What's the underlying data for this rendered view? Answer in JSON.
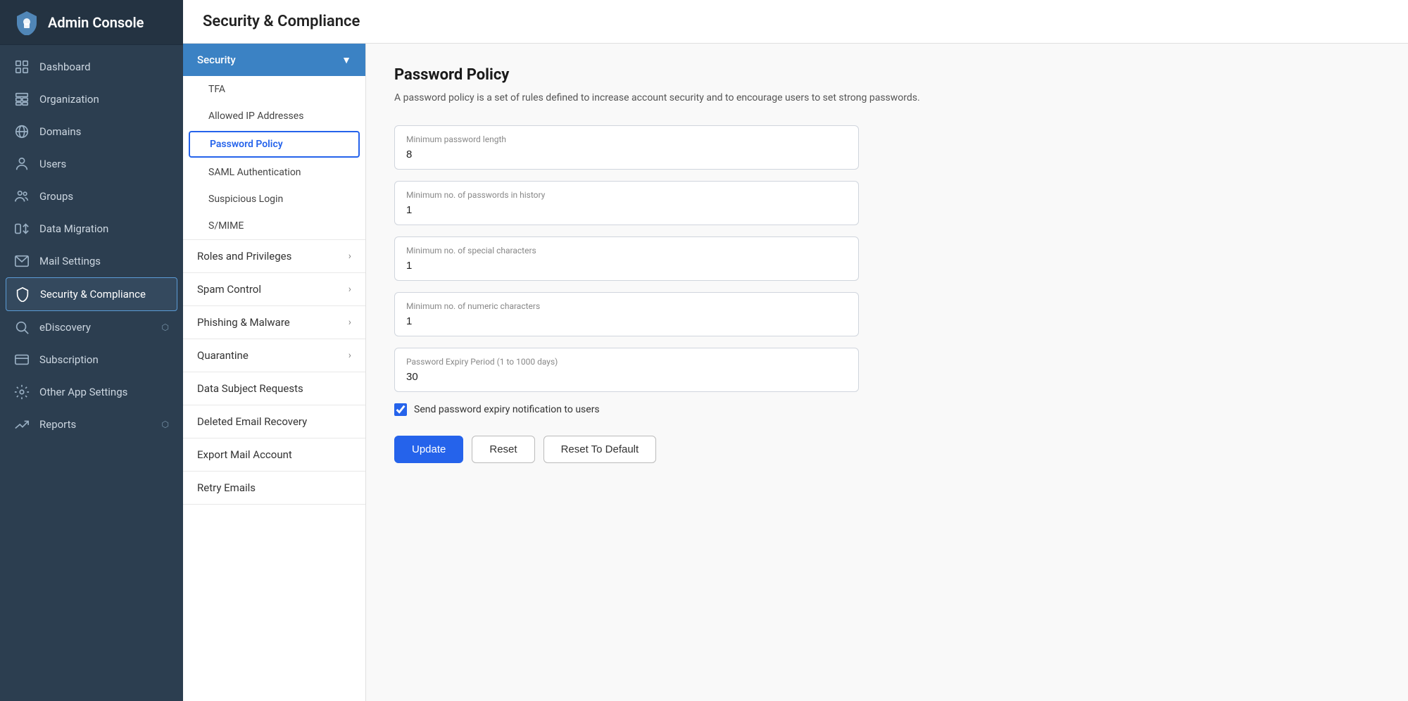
{
  "app": {
    "title": "Admin Console"
  },
  "sidebar": {
    "items": [
      {
        "id": "dashboard",
        "label": "Dashboard",
        "icon": "dashboard"
      },
      {
        "id": "organization",
        "label": "Organization",
        "icon": "organization"
      },
      {
        "id": "domains",
        "label": "Domains",
        "icon": "domains"
      },
      {
        "id": "users",
        "label": "Users",
        "icon": "users"
      },
      {
        "id": "groups",
        "label": "Groups",
        "icon": "groups"
      },
      {
        "id": "data-migration",
        "label": "Data Migration",
        "icon": "data-migration"
      },
      {
        "id": "mail-settings",
        "label": "Mail Settings",
        "icon": "mail-settings"
      },
      {
        "id": "security-compliance",
        "label": "Security & Compliance",
        "icon": "security",
        "active": true
      },
      {
        "id": "ediscovery",
        "label": "eDiscovery",
        "icon": "ediscovery",
        "ext": true
      },
      {
        "id": "subscription",
        "label": "Subscription",
        "icon": "subscription"
      },
      {
        "id": "other-app-settings",
        "label": "Other App Settings",
        "icon": "other-app"
      },
      {
        "id": "reports",
        "label": "Reports",
        "icon": "reports",
        "ext": true
      }
    ]
  },
  "page": {
    "title": "Security & Compliance"
  },
  "sub_sidebar": {
    "security_section": {
      "label": "Security",
      "items": [
        {
          "id": "tfa",
          "label": "TFA",
          "active": false
        },
        {
          "id": "allowed-ip",
          "label": "Allowed IP Addresses",
          "active": false
        },
        {
          "id": "password-policy",
          "label": "Password Policy",
          "active": true
        },
        {
          "id": "saml",
          "label": "SAML Authentication",
          "active": false
        },
        {
          "id": "suspicious-login",
          "label": "Suspicious Login",
          "active": false
        },
        {
          "id": "smime",
          "label": "S/MIME",
          "active": false
        }
      ]
    },
    "flat_items": [
      {
        "id": "roles-privileges",
        "label": "Roles and Privileges",
        "has_arrow": true
      },
      {
        "id": "spam-control",
        "label": "Spam Control",
        "has_arrow": true
      },
      {
        "id": "phishing-malware",
        "label": "Phishing & Malware",
        "has_arrow": true
      },
      {
        "id": "quarantine",
        "label": "Quarantine",
        "has_arrow": true
      },
      {
        "id": "data-subject-requests",
        "label": "Data Subject Requests",
        "has_arrow": false
      },
      {
        "id": "deleted-email-recovery",
        "label": "Deleted Email Recovery",
        "has_arrow": false
      },
      {
        "id": "export-mail-account",
        "label": "Export Mail Account",
        "has_arrow": false
      },
      {
        "id": "retry-emails",
        "label": "Retry Emails",
        "has_arrow": false
      }
    ]
  },
  "password_policy": {
    "title": "Password Policy",
    "description": "A password policy is a set of rules defined to increase account security and to encourage users to set strong passwords.",
    "fields": [
      {
        "id": "min-length",
        "label": "Minimum password length",
        "value": "8"
      },
      {
        "id": "min-history",
        "label": "Minimum no. of passwords in history",
        "value": "1"
      },
      {
        "id": "min-special",
        "label": "Minimum no. of special characters",
        "value": "1"
      },
      {
        "id": "min-numeric",
        "label": "Minimum no. of numeric characters",
        "value": "1"
      },
      {
        "id": "expiry-period",
        "label": "Password Expiry Period (1 to 1000 days)",
        "value": "30"
      }
    ],
    "checkbox": {
      "label": "Send password expiry notification to users",
      "checked": true
    },
    "buttons": {
      "update": "Update",
      "reset": "Reset",
      "reset_default": "Reset To Default"
    }
  }
}
